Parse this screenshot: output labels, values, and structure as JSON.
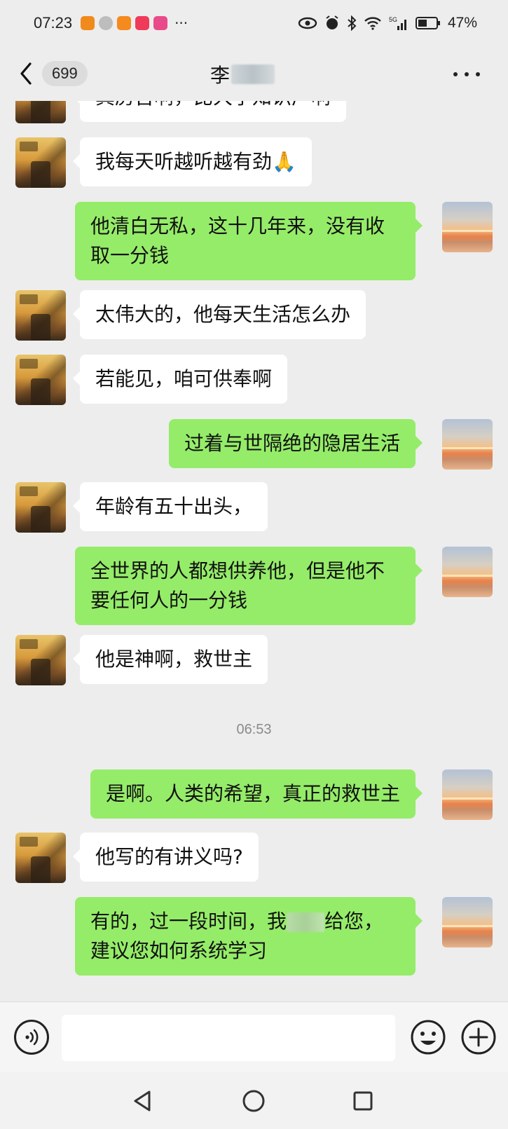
{
  "status_bar": {
    "time": "07:23",
    "more": "···",
    "battery": "47%",
    "network": "5G"
  },
  "header": {
    "back_count": "699",
    "title_visible": "李"
  },
  "messages": [
    {
      "side": "left",
      "text": "真房否啊，比大学知识广啊",
      "partial": true
    },
    {
      "side": "left",
      "text": "我每天听越听越有劲🙏"
    },
    {
      "side": "right",
      "text": "他清白无私，这十几年来，没有收取一分钱"
    },
    {
      "side": "left",
      "text": "太伟大的，他每天生活怎么办"
    },
    {
      "side": "left",
      "text": "若能见，咱可供奉啊"
    },
    {
      "side": "right",
      "text": "过着与世隔绝的隐居生活"
    },
    {
      "side": "left",
      "text": "年龄有五十出头，"
    },
    {
      "side": "right",
      "text": "全世界的人都想供养他，但是他不要任何人的一分钱"
    },
    {
      "side": "left",
      "text": "他是神啊，救世主"
    },
    {
      "side": "timestamp",
      "text": "06:53"
    },
    {
      "side": "right",
      "text": "是啊。人类的希望，真正的救世主"
    },
    {
      "side": "left",
      "text": "他写的有讲义吗?"
    },
    {
      "side": "right",
      "text_before": "有的，过一段时间，我",
      "text_after": "给您，建议您如何系统学习"
    }
  ],
  "icons": {
    "back": "chevron-left-icon",
    "more": "more-dots-icon",
    "voice": "voice-icon",
    "emoji": "emoji-icon",
    "plus": "plus-icon",
    "nav_back": "triangle-back-icon",
    "nav_home": "circle-home-icon",
    "nav_recent": "square-recent-icon"
  },
  "colors": {
    "background": "#ededed",
    "bubble_self": "#95ec69",
    "bubble_other": "#ffffff"
  }
}
